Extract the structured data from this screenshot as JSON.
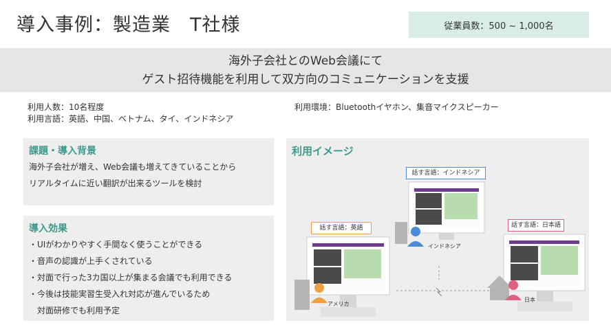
{
  "header": {
    "title": "導入事例：製造業　T社様",
    "employees": "従業員数：500 ~ 1,000名"
  },
  "banner": {
    "line1": "海外子会社とのWeb会議にて",
    "line2": "ゲスト招待機能を利用して双方向のコミュニケーションを支援"
  },
  "info": {
    "users": "利用人数：10名程度",
    "languages": "利用言語：英語、中国、ベトナム、タイ、インドネシア",
    "environment": "利用環境：Bluetoothイヤホン、集音マイクスピーカー"
  },
  "background": {
    "title": "課題・導入背景",
    "lines": [
      "海外子会社が増え、Web会議も増えてきていることから",
      "リアルタイムに近い翻訳が出来るツールを検討"
    ]
  },
  "effects": {
    "title": "導入効果",
    "lines": [
      "・UIがわかりやすく手間なく使うことができる",
      "・音声の認識が上手くされている",
      "・対面で行った3カ国以上が集まる会議でも利用できる",
      "・今後は技能実習生受入れ対応が進んでいるため",
      "　対面研修でも利用予定"
    ]
  },
  "image": {
    "title": "利用イメージ",
    "tag_english": "話す言語：英語",
    "tag_indonesian": "話す言語：インドネシア",
    "tag_japanese": "話す言語：日本語",
    "loc_america": "アメリカ",
    "loc_indonesia": "インドネシア",
    "loc_japan": "日本"
  },
  "colors": {
    "accent": "#3d9a8c",
    "badge_bg": "#d8ece8",
    "banner_bg": "#e6e6e6",
    "panel_bg": "#eeeeee",
    "orange": "#f0a040",
    "blue": "#4a8cd8",
    "pink": "#e06080"
  }
}
